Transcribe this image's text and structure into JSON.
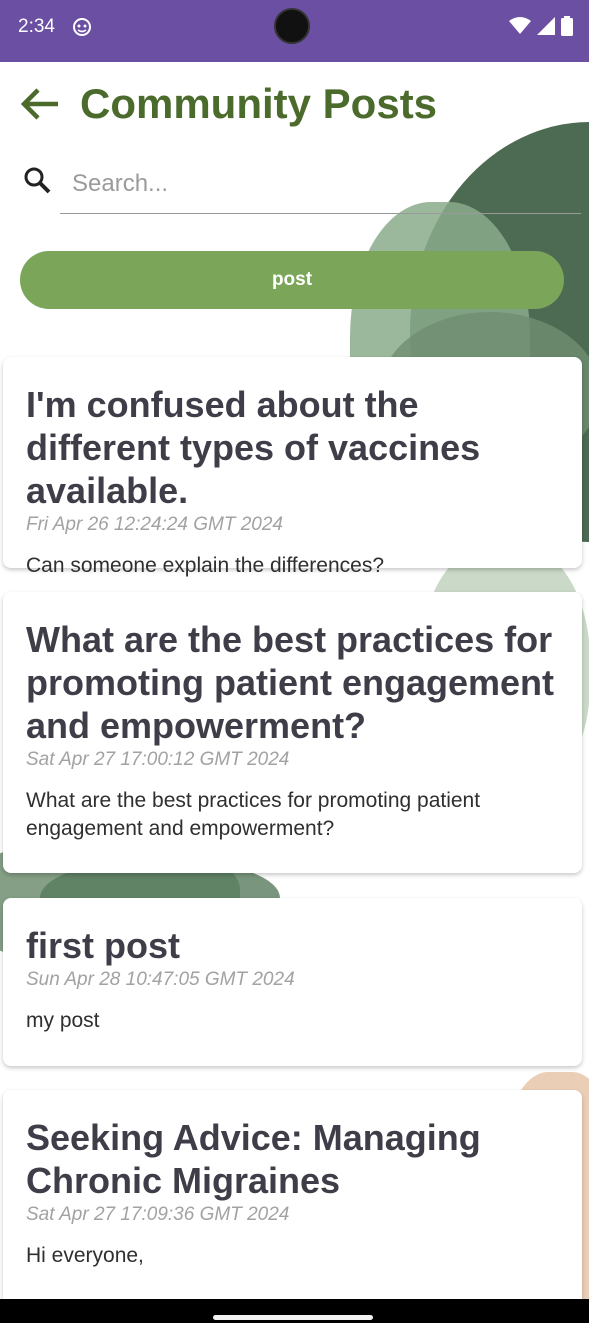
{
  "status_bar": {
    "time": "2:34",
    "color": "#6a4fa3"
  },
  "header": {
    "title": "Community Posts",
    "title_color": "#4b6b2d"
  },
  "search": {
    "placeholder": "Search...",
    "value": ""
  },
  "post_button": {
    "label": "post",
    "color": "#7ba659"
  },
  "posts": [
    {
      "title": "I'm confused about the different types of vaccines available.",
      "date": "Fri Apr 26 12:24:24 GMT 2024",
      "body": "Can someone explain the differences?"
    },
    {
      "title": "What are the best practices for promoting patient engagement and empowerment?",
      "date": "Sat Apr 27 17:00:12 GMT 2024",
      "body": "What are the best practices for promoting patient engagement and empowerment?"
    },
    {
      "title": "first post",
      "date": "Sun Apr 28 10:47:05 GMT 2024",
      "body": "my post"
    },
    {
      "title": "Seeking Advice: Managing Chronic Migraines",
      "date": "Sat Apr 27 17:09:36 GMT 2024",
      "body": "Hi everyone,"
    }
  ],
  "icons": {
    "back": "arrow-left-icon",
    "search": "search-icon",
    "wifi": "wifi-icon",
    "signal": "signal-icon",
    "battery": "battery-icon"
  }
}
